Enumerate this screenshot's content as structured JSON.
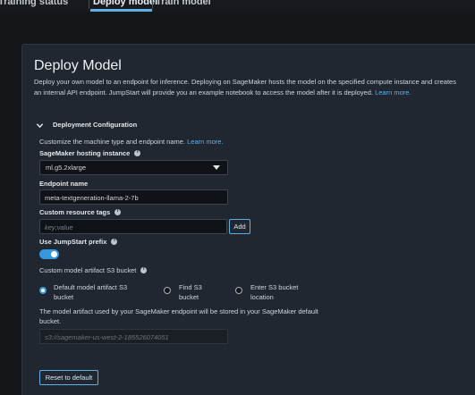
{
  "tabs": {
    "training_status": "Training status",
    "deploy_model": "Deploy model",
    "train_model": "Train model",
    "active": "Deploy model"
  },
  "deploy": {
    "title": "Deploy Model",
    "description": "Deploy your own model to an endpoint for inference. Deploying on SageMaker hosts the model on the specified compute instance and creates an internal API endpoint. JumpStart will provide you an example notebook to access the model after it is deployed.",
    "learn_more": "Learn more."
  },
  "config": {
    "section_title": "Deployment Configuration",
    "customize_text": "Customize the machine type and endpoint name.",
    "learn_more": "Learn more.",
    "hosting_instance_label": "SageMaker hosting instance",
    "hosting_instance_value": "ml.g5.2xlarge",
    "endpoint_name_label": "Endpoint name",
    "endpoint_name_value": "meta-textgeneration-llama-2-7b",
    "tags_label": "Custom resource tags",
    "tags_placeholder": "key;value",
    "add_button": "Add",
    "jumpstart_prefix_label": "Use JumpStart prefix",
    "jumpstart_prefix_enabled": true,
    "s3_bucket_label": "Custom model artifact S3 bucket",
    "s3_options": [
      {
        "line1": "Default model artifact S3",
        "line2": "bucket",
        "selected": true
      },
      {
        "line1": "Find S3",
        "line2": "bucket",
        "selected": false
      },
      {
        "line1": "Enter S3 bucket",
        "line2": "location",
        "selected": false
      }
    ],
    "s3_note": "The model artifact used by your SageMaker endpoint will be stored in your SageMaker default bucket.",
    "s3_placeholder": "s3://sagemaker-us-west-2-185526074051",
    "reset_button": "Reset to default"
  },
  "colors": {
    "background": "#141619",
    "panel": "#212730",
    "accent": "#5eb0e6",
    "toggle_on": "#3796dc"
  }
}
